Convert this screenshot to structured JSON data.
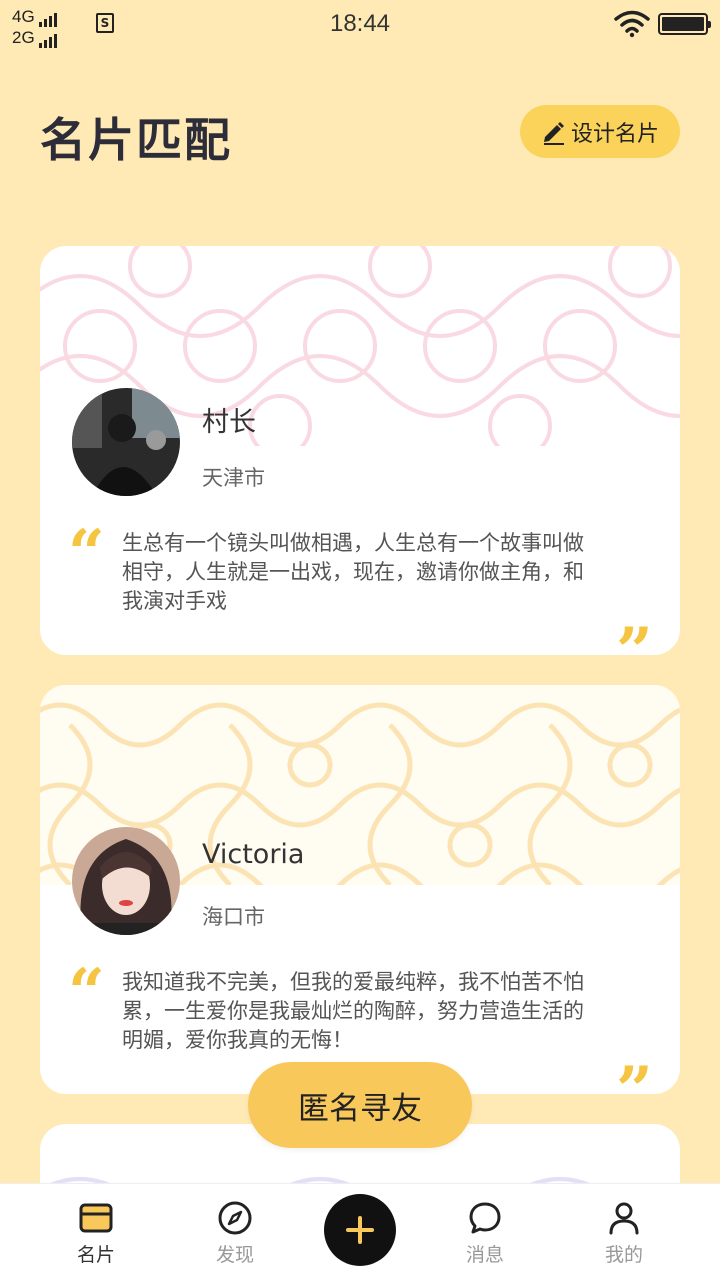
{
  "status_bar": {
    "net_top": "4G",
    "net_bottom": "2G",
    "sim_label": "S",
    "time": "18:44"
  },
  "header": {
    "title": "名片匹配",
    "design_button": "设计名片"
  },
  "cards": [
    {
      "name": "村长",
      "city": "天津市",
      "quote": "生总有一个镜头叫做相遇，人生总有一个故事叫做相守，人生就是一出戏，现在，邀请你做主角，和我演对手戏",
      "pattern_color": "#F9D9E2"
    },
    {
      "name": "Victoria",
      "city": "海口市",
      "quote": "我知道我不完美，但我的爱最纯粹，我不怕苦不怕累，一生爱你是我最灿烂的陶醉，努力营造生活的明媚，爱你我真的无悔！",
      "pattern_color": "#FCE3B4"
    },
    {
      "pattern_color": "#E4DFF7"
    }
  ],
  "quote_marks": {
    "open": "“",
    "close": "”"
  },
  "floating_button": "匿名寻友",
  "bottom_nav": {
    "items": [
      {
        "label": "名片",
        "icon": "card-icon",
        "active": true
      },
      {
        "label": "发现",
        "icon": "compass-icon",
        "active": false
      },
      {
        "label": "",
        "icon": "plus-icon",
        "active": false
      },
      {
        "label": "消息",
        "icon": "chat-bubble-icon",
        "active": false
      },
      {
        "label": "我的",
        "icon": "person-icon",
        "active": false
      }
    ]
  },
  "colors": {
    "background": "#FFEAB6",
    "accent": "#FBD35A",
    "quote_mark": "#F5C542"
  }
}
